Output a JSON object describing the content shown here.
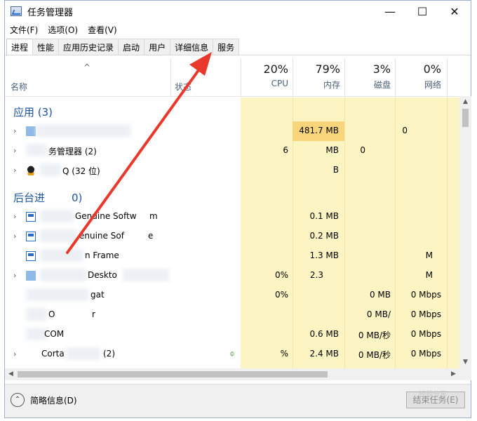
{
  "window": {
    "title": "任务管理器",
    "controls": {
      "minimize": "—",
      "maximize": "☐",
      "close": "✕"
    }
  },
  "menu": [
    "文件(F)",
    "选项(O)",
    "查看(V)"
  ],
  "tabs": [
    "进程",
    "性能",
    "应用历史记录",
    "启动",
    "用户",
    "详细信息",
    "服务"
  ],
  "active_tab": "进程",
  "columns": {
    "sort_arrow": "^",
    "name": "名称",
    "status": "状态",
    "cpu": {
      "pct": "20%",
      "label": "CPU"
    },
    "memory": {
      "pct": "79%",
      "label": "内存"
    },
    "disk": {
      "pct": "3%",
      "label": "磁盘"
    },
    "network": {
      "pct": "0%",
      "label": "网络"
    }
  },
  "groups": {
    "apps": "应用 (3)",
    "background": "后台进",
    "background_count": "0)"
  },
  "rows": [
    {
      "name": "",
      "cpu": "",
      "mem": "481.7 MB",
      "disk": "",
      "net": "0"
    },
    {
      "name": "务管理器 (2)",
      "cpu": "6",
      "mem": "MB",
      "disk": "0",
      "net": ""
    },
    {
      "name": "Q (32 位)",
      "cpu": "",
      "mem": "B",
      "disk": "",
      "net": ""
    },
    {
      "name": "Genuine Softw",
      "name2": "m",
      "cpu": "",
      "mem": "0.1 MB",
      "disk": "",
      "net": ""
    },
    {
      "name": "enuine Sof",
      "name2": "e",
      "cpu": "",
      "mem": "0.2 MB",
      "disk": "",
      "net": ""
    },
    {
      "name": "n Frame",
      "cpu": "",
      "mem": "1.3 MB",
      "disk": "",
      "net": "M"
    },
    {
      "name": "Deskto",
      "cpu": "0%",
      "mem": "2.3",
      "disk": "",
      "net": "M"
    },
    {
      "name": "gat",
      "cpu": "0%",
      "mem": "",
      "disk": "0 MB",
      "net": "0 Mbps"
    },
    {
      "name": "O",
      "name2": "r",
      "cpu": "",
      "mem": "",
      "disk": "0 MB/",
      "net": "0 Mbps"
    },
    {
      "name": "COM",
      "cpu": "",
      "mem": "0.6 MB",
      "disk": "0 MB/秒",
      "net": "0 Mbps"
    },
    {
      "name": "Corta",
      "name2": "(2)",
      "cpu": "%",
      "mem": "2.4 MB",
      "disk": "0 MB/秒",
      "net": "0 Mbps"
    }
  ],
  "footer": {
    "fewer_details": "简略信息(D)",
    "end_task": "结束任务(E)",
    "watermark": "经验分享"
  },
  "colors": {
    "heat_light": "#fdf4c4",
    "heat_hot": "#f8d57a",
    "group_text": "#1e56a0",
    "arrow": "#e8392c"
  }
}
